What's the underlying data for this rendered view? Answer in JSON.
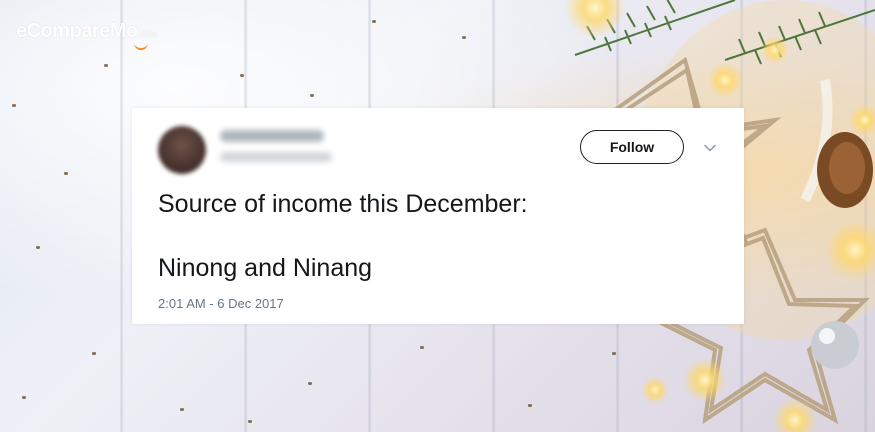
{
  "brand": {
    "name": "eCompareMo",
    "suffix": ".com",
    "accent": "#f28c1a"
  },
  "tweet": {
    "author_name": "Daddy Santa",
    "author_handle": "@askdaddysanta",
    "follow_label": "Follow",
    "lines": [
      "Source of income this December:",
      "Ninong and Ninang"
    ],
    "timestamp": "2:01 AM - 6 Dec 2017"
  },
  "icons": {
    "chevron": "chevron-down-icon",
    "avatar": "avatar"
  },
  "colors": {
    "text_primary": "#14171a",
    "text_secondary": "#657786",
    "card_bg": "#ffffff"
  }
}
